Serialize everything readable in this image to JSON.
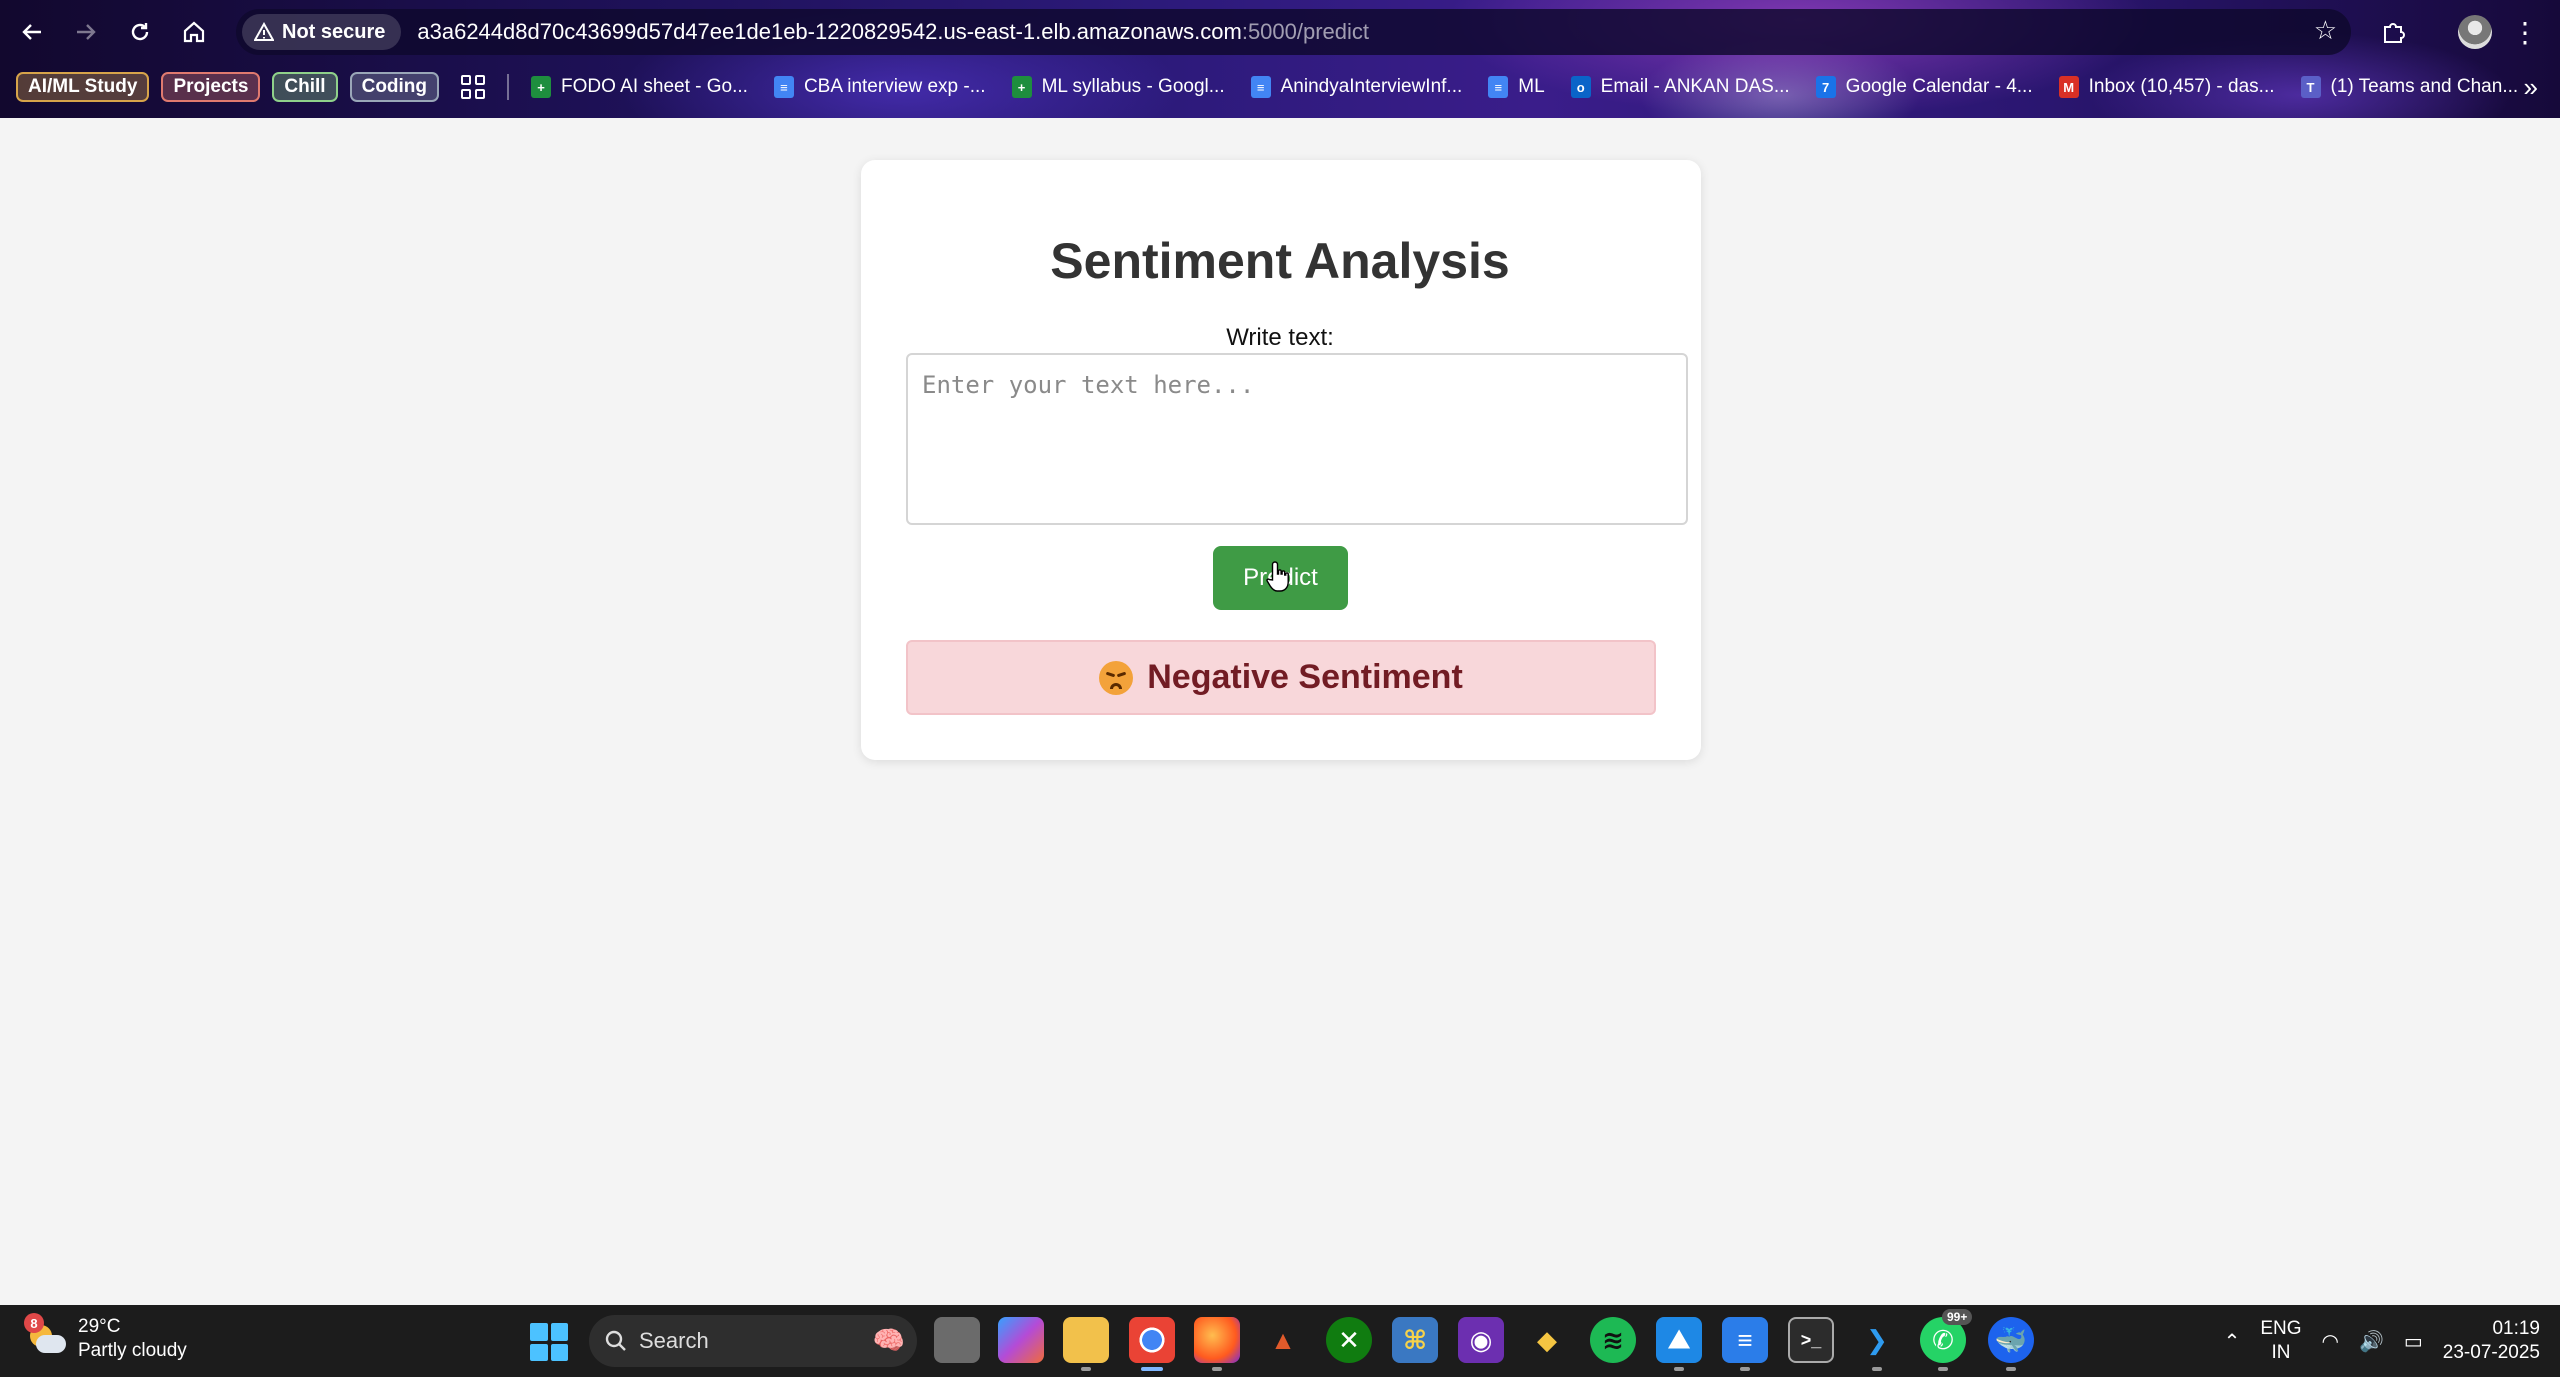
{
  "browser": {
    "security_label": "Not secure",
    "url_host": "a3a6244d8d70c43699d57d47ee1de1eb-1220829542.us-east-1.elb.amazonaws.com",
    "url_path": ":5000/predict",
    "tab_groups": [
      {
        "label": "AI/ML Study",
        "color": "#d7a44a"
      },
      {
        "label": "Projects",
        "color": "#e07a6f"
      },
      {
        "label": "Chill",
        "color": "#8fd18a"
      },
      {
        "label": "Coding",
        "color": "#9aa7b8"
      }
    ],
    "bookmarks": [
      {
        "label": "FODO AI sheet - Go...",
        "icon": "sheets-icon",
        "color": "#1e8e3e",
        "glyph": "+"
      },
      {
        "label": "CBA interview exp -...",
        "icon": "docs-icon",
        "color": "#4285f4",
        "glyph": "≡"
      },
      {
        "label": "ML syllabus - Googl...",
        "icon": "sheets-icon",
        "color": "#1e8e3e",
        "glyph": "+"
      },
      {
        "label": "AnindyaInterviewInf...",
        "icon": "docs-icon",
        "color": "#4285f4",
        "glyph": "≡"
      },
      {
        "label": "ML",
        "icon": "docs-icon",
        "color": "#4285f4",
        "glyph": "≡"
      },
      {
        "label": "Email - ANKAN DAS...",
        "icon": "outlook-icon",
        "color": "#0a64c8",
        "glyph": "o"
      },
      {
        "label": "Google Calendar - 4...",
        "icon": "calendar-icon",
        "color": "#1a73e8",
        "glyph": "7"
      },
      {
        "label": "Inbox (10,457) - das...",
        "icon": "gmail-icon",
        "color": "#d93025",
        "glyph": "M"
      },
      {
        "label": "(1) Teams and Chan...",
        "icon": "teams-icon",
        "color": "#5b5fc7",
        "glyph": "T"
      }
    ]
  },
  "page": {
    "title": "Sentiment Analysis",
    "field_label": "Write text:",
    "textarea_placeholder": "Enter your text here...",
    "textarea_value": "",
    "predict_label": "Predict",
    "result_label": "Negative Sentiment",
    "result_icon": "sad-face-icon",
    "colors": {
      "button": "#3f9b45",
      "result_bg": "#f8d7da",
      "result_text": "#721c24"
    }
  },
  "taskbar": {
    "weather_badge": "8",
    "weather_temp": "29°C",
    "weather_desc": "Partly cloudy",
    "search_placeholder": "Search",
    "apps_badge": "99+",
    "lang_primary": "ENG",
    "lang_secondary": "IN",
    "time": "01:19",
    "date": "23-07-2025"
  }
}
